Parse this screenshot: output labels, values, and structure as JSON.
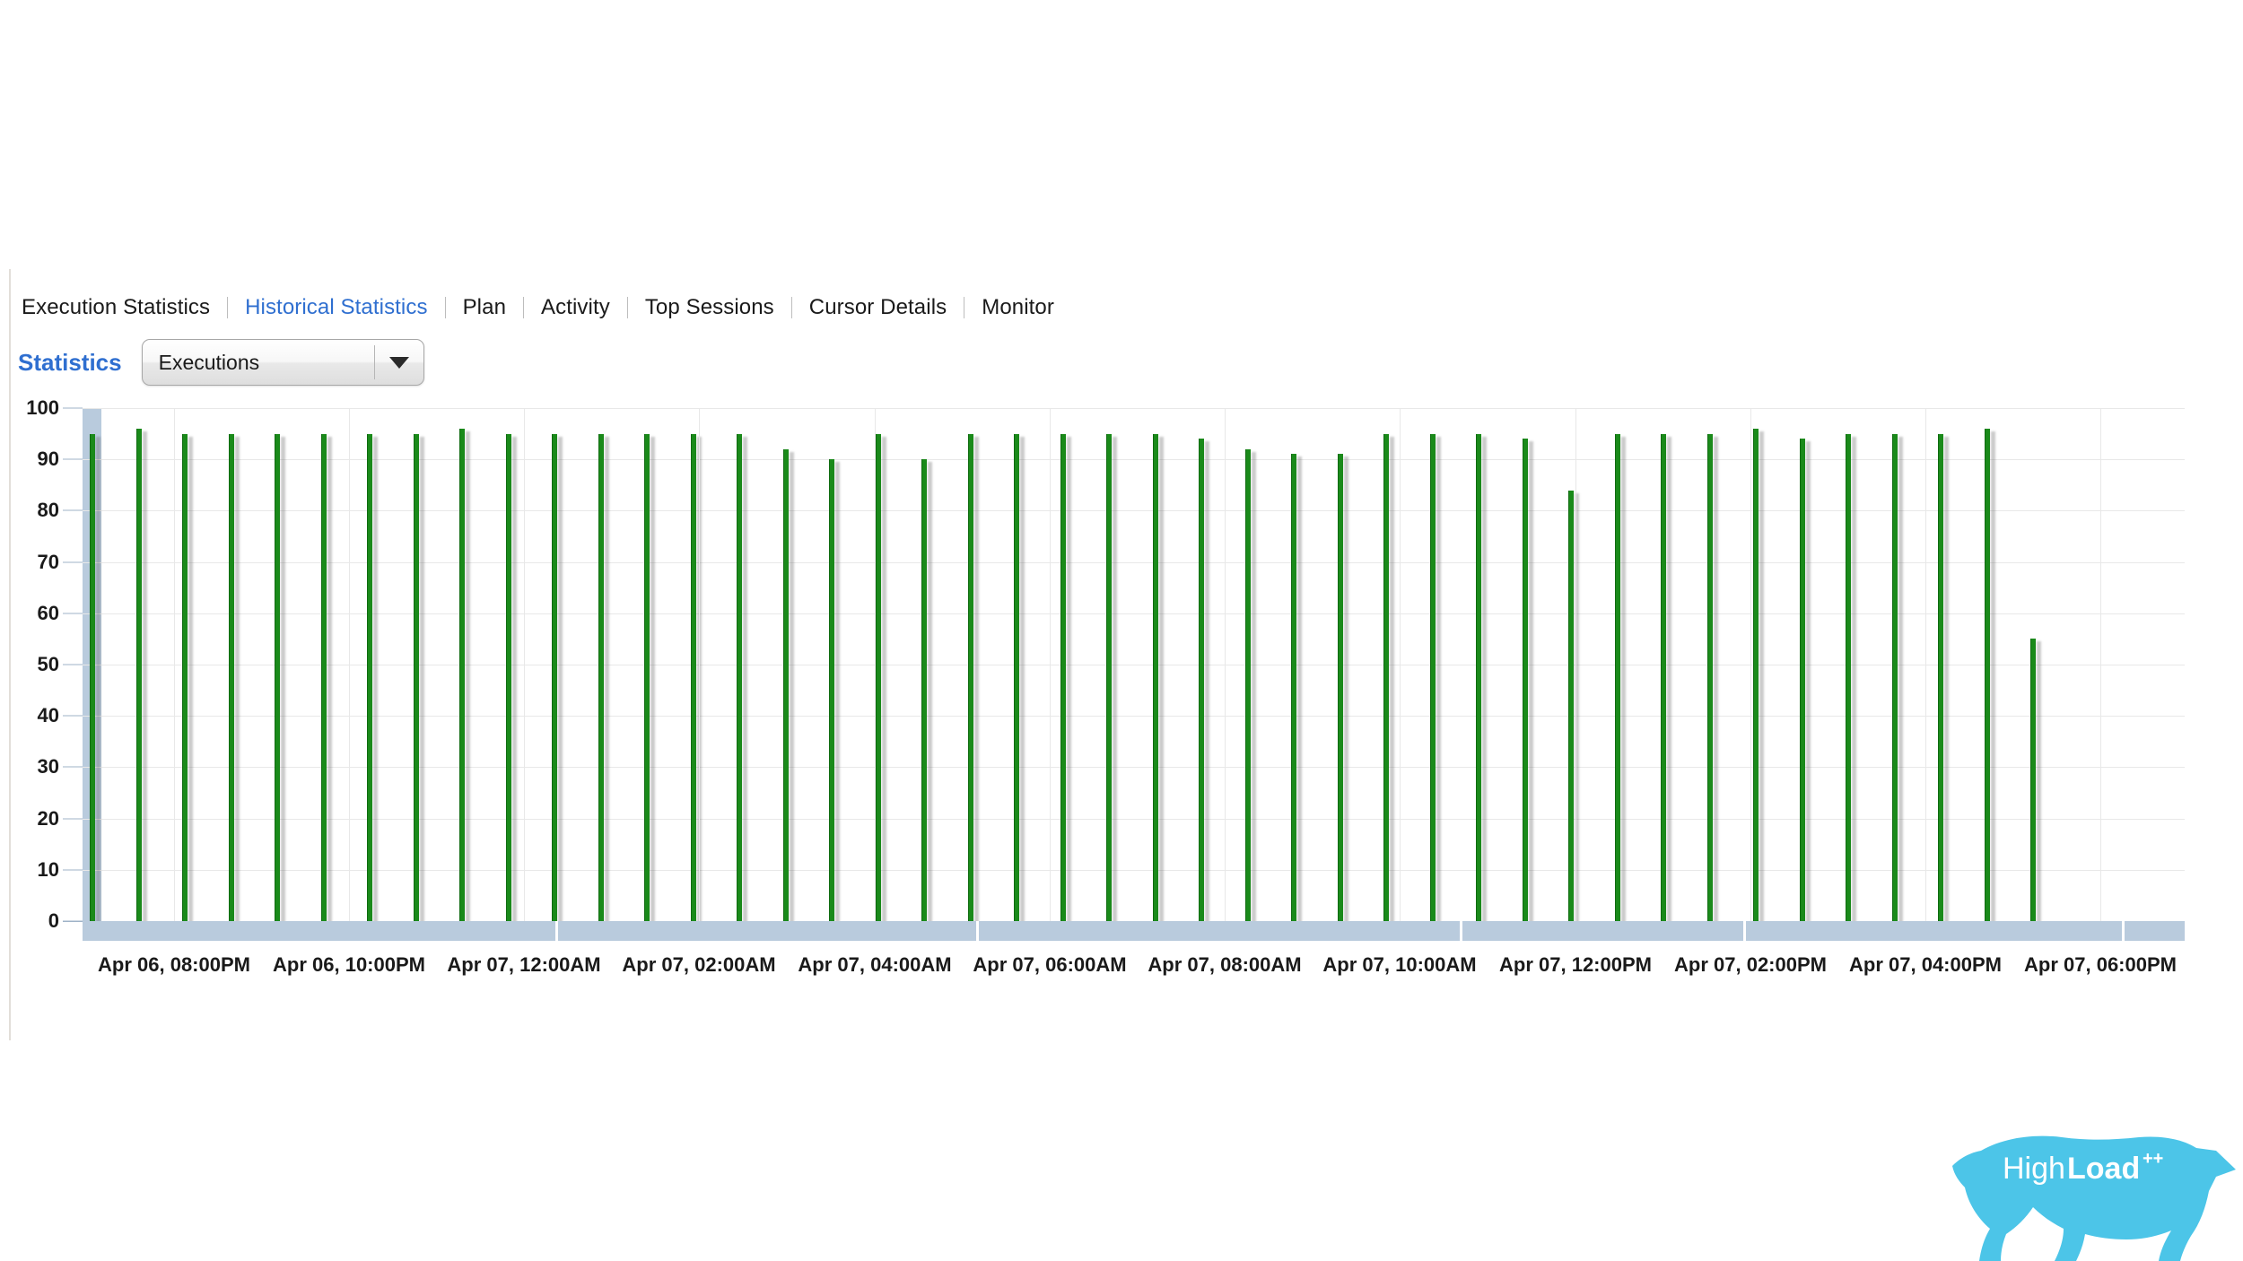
{
  "nav": {
    "items": [
      {
        "label": "Execution Statistics",
        "active": false
      },
      {
        "label": "Historical Statistics",
        "active": true
      },
      {
        "label": "Plan",
        "active": false
      },
      {
        "label": "Activity",
        "active": false
      },
      {
        "label": "Top Sessions",
        "active": false
      },
      {
        "label": "Cursor Details",
        "active": false
      },
      {
        "label": "Monitor",
        "active": false
      }
    ]
  },
  "statistics": {
    "label": "Statistics",
    "selected": "Executions",
    "options": [
      "Executions"
    ],
    "dropdown_icon": "chevron-down-icon"
  },
  "logo": {
    "text_light": "High",
    "text_bold": "Load",
    "superscript": "++",
    "color": "#4cc5e8"
  },
  "colors": {
    "bar": "#1a8a1a",
    "bar_edge": "#0f6b10",
    "active_link": "#2f6fd0",
    "range_band": "#b9cbdd",
    "gridline": "#e8e8e8"
  },
  "chart_data": {
    "type": "bar",
    "title": "",
    "xlabel": "",
    "ylabel": "",
    "ylim": [
      0,
      100
    ],
    "yticks": [
      0,
      10,
      20,
      30,
      40,
      50,
      60,
      70,
      80,
      90,
      100
    ],
    "grid": true,
    "legend": null,
    "xtick_labels": [
      "Apr 06, 08:00PM",
      "Apr 06, 10:00PM",
      "Apr 07, 12:00AM",
      "Apr 07, 02:00AM",
      "Apr 07, 04:00AM",
      "Apr 07, 06:00AM",
      "Apr 07, 08:00AM",
      "Apr 07, 10:00AM",
      "Apr 07, 12:00PM",
      "Apr 07, 02:00PM",
      "Apr 07, 04:00PM",
      "Apr 07, 06:00PM"
    ],
    "series": [
      {
        "name": "Executions",
        "values": [
          95,
          96,
          95,
          95,
          95,
          95,
          95,
          95,
          96,
          95,
          95,
          95,
          95,
          95,
          95,
          92,
          90,
          95,
          90,
          95,
          95,
          95,
          95,
          95,
          94,
          92,
          91,
          91,
          95,
          95,
          95,
          94,
          84,
          95,
          95,
          95,
          96,
          94,
          95,
          95,
          95,
          96,
          55
        ]
      }
    ]
  }
}
